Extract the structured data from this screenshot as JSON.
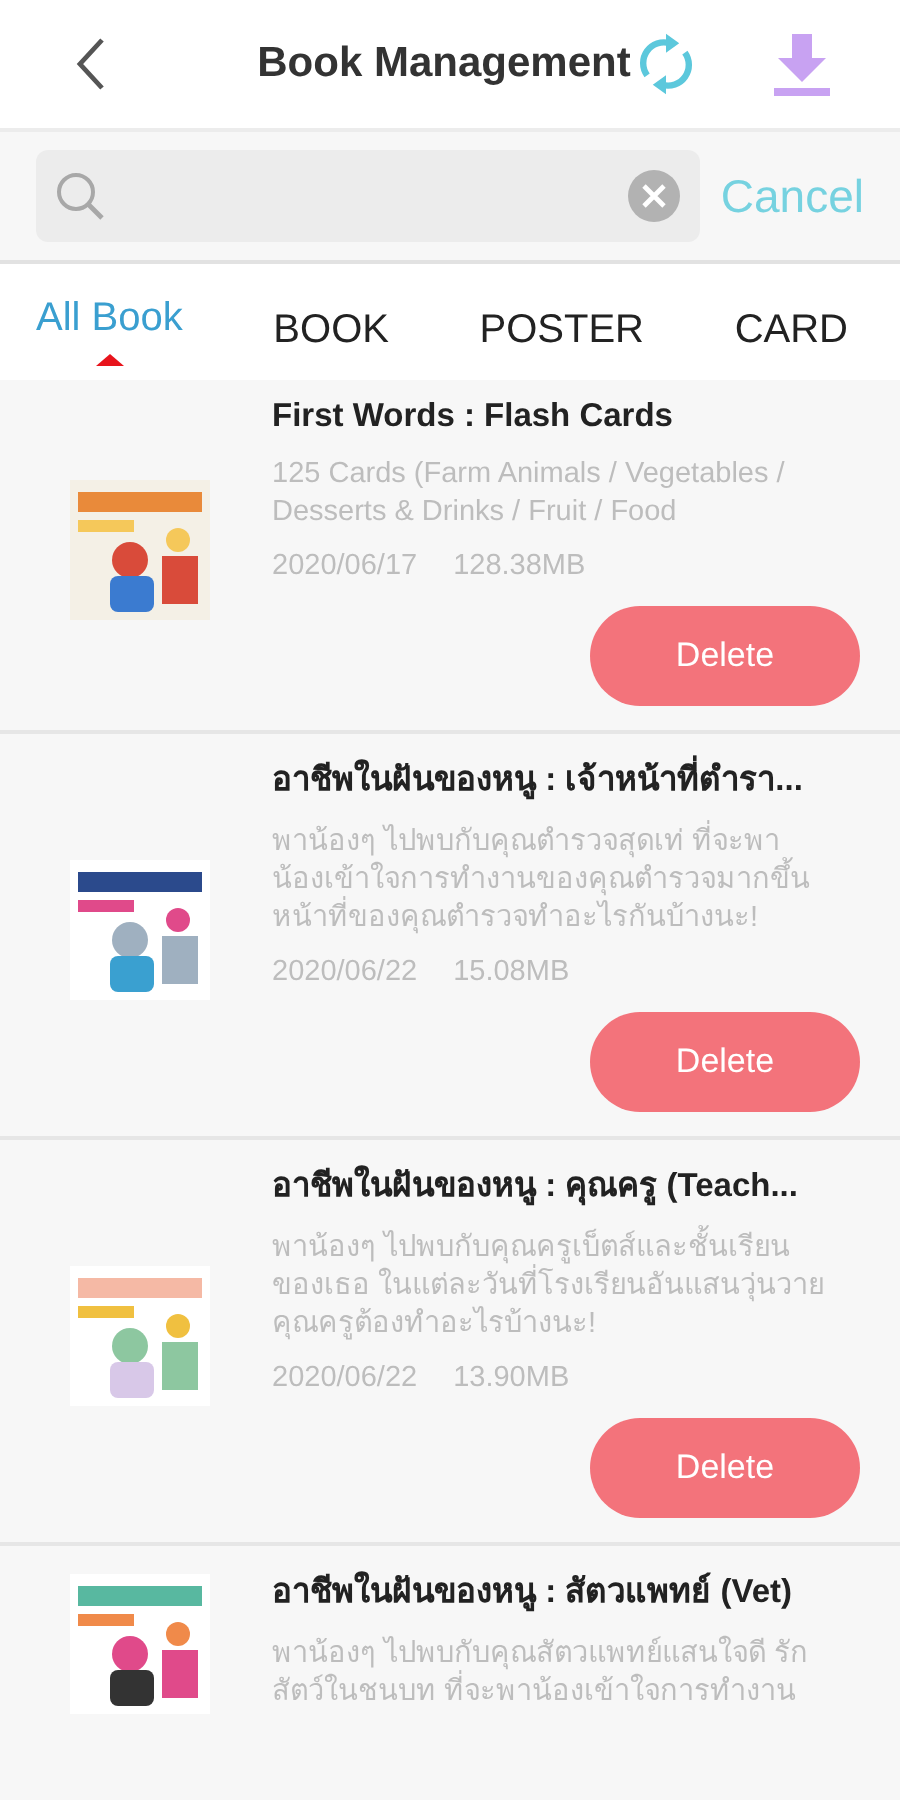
{
  "header": {
    "title": "Book Management"
  },
  "search": {
    "cancel": "Cancel"
  },
  "tabs": [
    {
      "label": "All Book",
      "selected": true
    },
    {
      "label": "BOOK",
      "selected": false
    },
    {
      "label": "POSTER",
      "selected": false
    },
    {
      "label": "CARD",
      "selected": false
    }
  ],
  "books": [
    {
      "title": "First Words : Flash Cards",
      "description": "125 Cards (Farm Animals / Vegetables /\nDesserts & Drinks / Fruit / Food",
      "date": "2020/06/17",
      "size": "128.38MB",
      "action": "Delete"
    },
    {
      "title": "อาชีพในฝันของหนู : เจ้าหน้าที่ตำรา...",
      "description": "พาน้องๆ ไปพบกับคุณตำรวจสุดเท่ ที่จะพา\nน้องเข้าใจการทำงานของคุณตำรวจมากขึ้น\nหน้าที่ของคุณตำรวจทำอะไรกันบ้างนะ!",
      "date": "2020/06/22",
      "size": "15.08MB",
      "action": "Delete"
    },
    {
      "title": "อาชีพในฝันของหนู : คุณครู (Teach...",
      "description": "พาน้องๆ ไปพบกับคุณครูเบ็ตส์และชั้นเรียน\nของเธอ ในแต่ละวันที่โรงเรียนอันแสนวุ่นวาย\nคุณครูต้องทำอะไรบ้างนะ!",
      "date": "2020/06/22",
      "size": "13.90MB",
      "action": "Delete"
    },
    {
      "title": "อาชีพในฝันของหนู : สัตวแพทย์ (Vet)",
      "description": "พาน้องๆ ไปพบกับคุณสัตวแพทย์แสนใจดี รัก\nสัตว์ในชนบท ที่จะพาน้องเข้าใจการทำงาน"
    }
  ]
}
